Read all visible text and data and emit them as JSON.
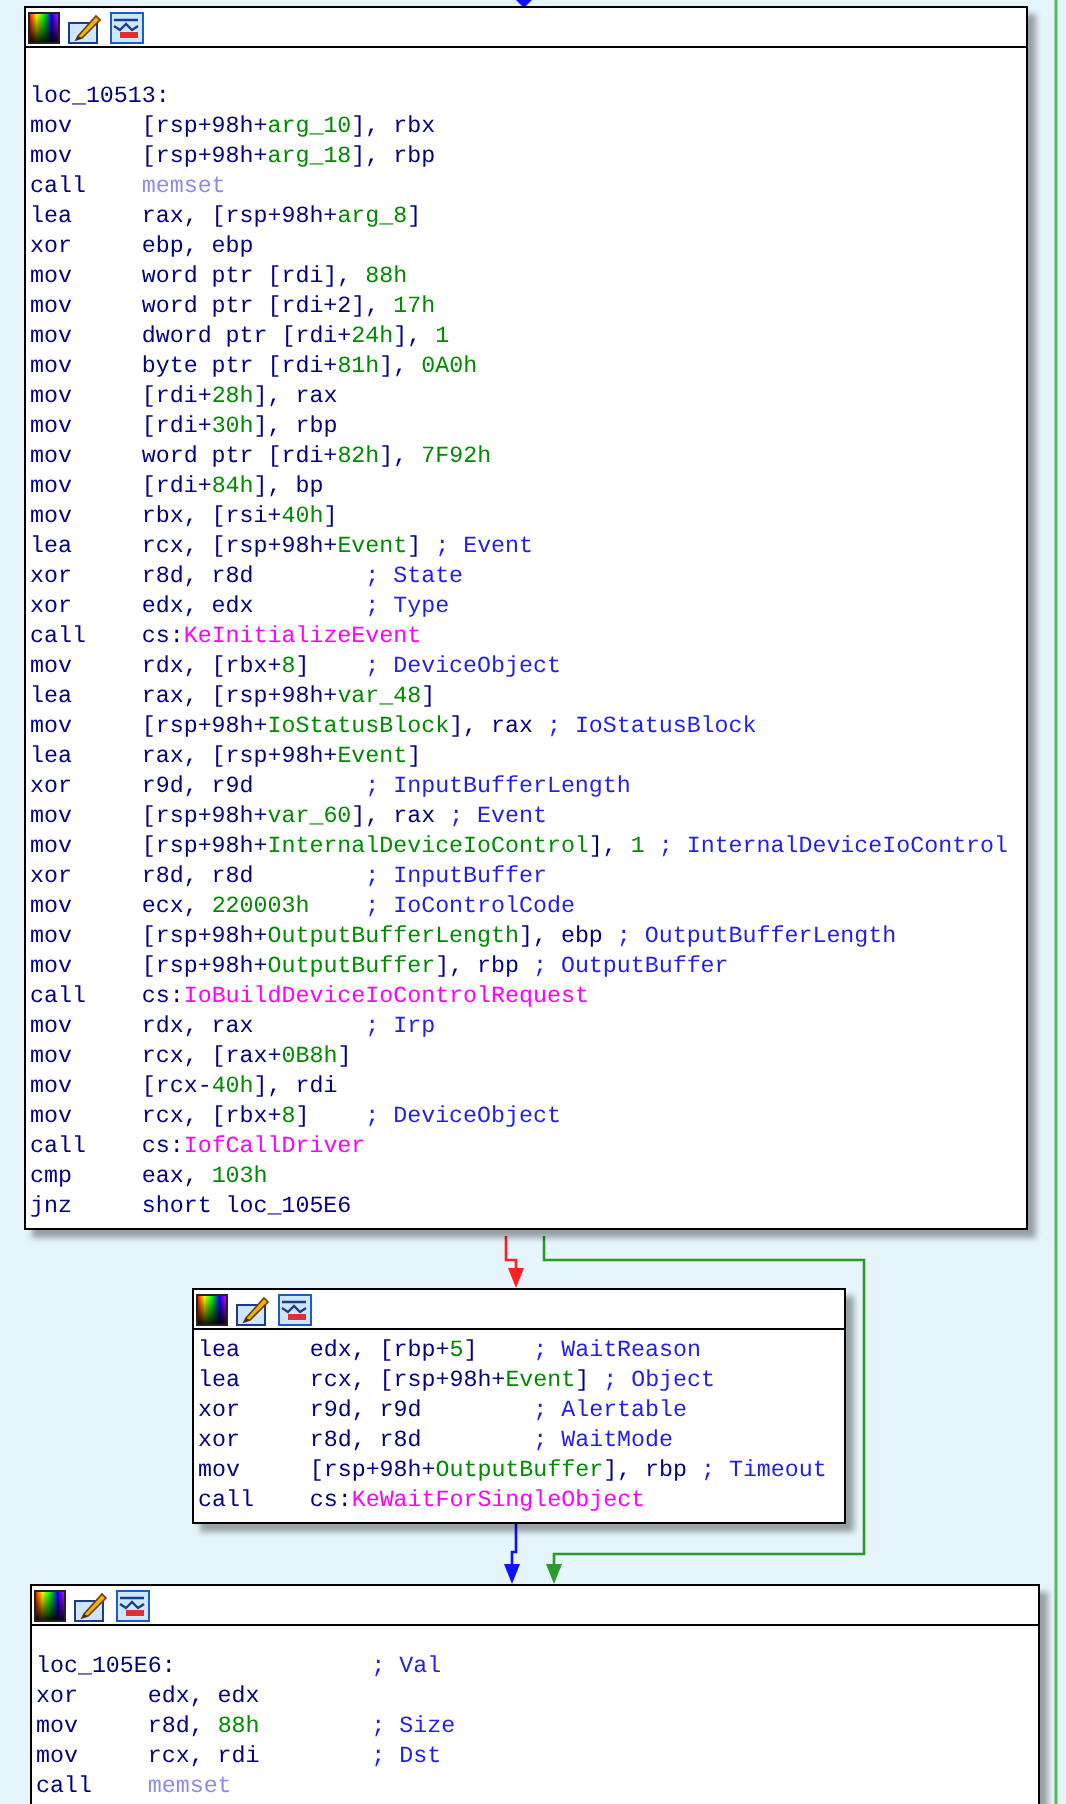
{
  "blocks": [
    {
      "lines": [
        {
          "kind": "label",
          "op": "loc_10513:"
        },
        {
          "kind": "insn",
          "op": "mov",
          "args": [
            {
              "text": "[rsp+98h+",
              "kind": "plain"
            },
            {
              "text": "arg_10",
              "kind": "var"
            },
            {
              "text": "], rbx",
              "kind": "plain"
            }
          ]
        },
        {
          "kind": "insn",
          "op": "mov",
          "args": [
            {
              "text": "[rsp+98h+",
              "kind": "plain"
            },
            {
              "text": "arg_18",
              "kind": "var"
            },
            {
              "text": "], rbp",
              "kind": "plain"
            }
          ]
        },
        {
          "kind": "insn",
          "op": "call",
          "args": [
            {
              "text": "memset",
              "kind": "libfunc"
            }
          ]
        },
        {
          "kind": "insn",
          "op": "lea",
          "args": [
            {
              "text": "rax, [rsp+98h+",
              "kind": "plain"
            },
            {
              "text": "arg_8",
              "kind": "var"
            },
            {
              "text": "]",
              "kind": "plain"
            }
          ]
        },
        {
          "kind": "insn",
          "op": "xor",
          "args": [
            {
              "text": "ebp, ebp",
              "kind": "plain"
            }
          ]
        },
        {
          "kind": "insn",
          "op": "mov",
          "args": [
            {
              "text": "word ptr [rdi], ",
              "kind": "plain"
            },
            {
              "text": "88h",
              "kind": "number"
            }
          ]
        },
        {
          "kind": "insn",
          "op": "mov",
          "args": [
            {
              "text": "word ptr [rdi+2], ",
              "kind": "plain"
            },
            {
              "text": "17h",
              "kind": "number"
            }
          ]
        },
        {
          "kind": "insn",
          "op": "mov",
          "args": [
            {
              "text": "dword ptr [rdi+",
              "kind": "plain"
            },
            {
              "text": "24h",
              "kind": "number"
            },
            {
              "text": "], ",
              "kind": "plain"
            },
            {
              "text": "1",
              "kind": "number"
            }
          ]
        },
        {
          "kind": "insn",
          "op": "mov",
          "args": [
            {
              "text": "byte ptr [rdi+",
              "kind": "plain"
            },
            {
              "text": "81h",
              "kind": "number"
            },
            {
              "text": "], ",
              "kind": "plain"
            },
            {
              "text": "0A0h",
              "kind": "number"
            }
          ]
        },
        {
          "kind": "insn",
          "op": "mov",
          "args": [
            {
              "text": "[rdi+",
              "kind": "plain"
            },
            {
              "text": "28h",
              "kind": "number"
            },
            {
              "text": "], rax",
              "kind": "plain"
            }
          ]
        },
        {
          "kind": "insn",
          "op": "mov",
          "args": [
            {
              "text": "[rdi+",
              "kind": "plain"
            },
            {
              "text": "30h",
              "kind": "number"
            },
            {
              "text": "], rbp",
              "kind": "plain"
            }
          ]
        },
        {
          "kind": "insn",
          "op": "mov",
          "args": [
            {
              "text": "word ptr [rdi+",
              "kind": "plain"
            },
            {
              "text": "82h",
              "kind": "number"
            },
            {
              "text": "], ",
              "kind": "plain"
            },
            {
              "text": "7F92h",
              "kind": "number"
            }
          ]
        },
        {
          "kind": "insn",
          "op": "mov",
          "args": [
            {
              "text": "[rdi+",
              "kind": "plain"
            },
            {
              "text": "84h",
              "kind": "number"
            },
            {
              "text": "], bp",
              "kind": "plain"
            }
          ]
        },
        {
          "kind": "insn",
          "op": "mov",
          "args": [
            {
              "text": "rbx, [rsi+",
              "kind": "plain"
            },
            {
              "text": "40h",
              "kind": "number"
            },
            {
              "text": "]",
              "kind": "plain"
            }
          ]
        },
        {
          "kind": "insn",
          "op": "lea",
          "args": [
            {
              "text": "rcx, [rsp+98h+",
              "kind": "plain"
            },
            {
              "text": "Event",
              "kind": "var"
            },
            {
              "text": "]",
              "kind": "plain"
            }
          ],
          "comment": "; Event"
        },
        {
          "kind": "insn",
          "op": "xor",
          "args": [
            {
              "text": "r8d, r8d",
              "kind": "plain"
            }
          ],
          "comment": "; State"
        },
        {
          "kind": "insn",
          "op": "xor",
          "args": [
            {
              "text": "edx, edx",
              "kind": "plain"
            }
          ],
          "comment": "; Type"
        },
        {
          "kind": "insn",
          "op": "call",
          "args": [
            {
              "text": "cs:",
              "kind": "plain"
            },
            {
              "text": "KeInitializeEvent",
              "kind": "import"
            }
          ]
        },
        {
          "kind": "insn",
          "op": "mov",
          "args": [
            {
              "text": "rdx, [rbx+",
              "kind": "plain"
            },
            {
              "text": "8",
              "kind": "number"
            },
            {
              "text": "]",
              "kind": "plain"
            }
          ],
          "comment": "; DeviceObject"
        },
        {
          "kind": "insn",
          "op": "lea",
          "args": [
            {
              "text": "rax, [rsp+98h+",
              "kind": "plain"
            },
            {
              "text": "var_48",
              "kind": "var"
            },
            {
              "text": "]",
              "kind": "plain"
            }
          ]
        },
        {
          "kind": "insn",
          "op": "mov",
          "args": [
            {
              "text": "[rsp+98h+",
              "kind": "plain"
            },
            {
              "text": "IoStatusBlock",
              "kind": "var"
            },
            {
              "text": "], rax",
              "kind": "plain"
            }
          ],
          "comment": "; IoStatusBlock"
        },
        {
          "kind": "insn",
          "op": "lea",
          "args": [
            {
              "text": "rax, [rsp+98h+",
              "kind": "plain"
            },
            {
              "text": "Event",
              "kind": "var"
            },
            {
              "text": "]",
              "kind": "plain"
            }
          ]
        },
        {
          "kind": "insn",
          "op": "xor",
          "args": [
            {
              "text": "r9d, r9d",
              "kind": "plain"
            }
          ],
          "comment": "; InputBufferLength"
        },
        {
          "kind": "insn",
          "op": "mov",
          "args": [
            {
              "text": "[rsp+98h+",
              "kind": "plain"
            },
            {
              "text": "var_60",
              "kind": "var"
            },
            {
              "text": "], rax",
              "kind": "plain"
            }
          ],
          "comment": "; Event"
        },
        {
          "kind": "insn",
          "op": "mov",
          "args": [
            {
              "text": "[rsp+98h+",
              "kind": "plain"
            },
            {
              "text": "InternalDeviceIoControl",
              "kind": "var"
            },
            {
              "text": "], ",
              "kind": "plain"
            },
            {
              "text": "1",
              "kind": "number"
            }
          ],
          "comment": "; InternalDeviceIoControl"
        },
        {
          "kind": "insn",
          "op": "xor",
          "args": [
            {
              "text": "r8d, r8d",
              "kind": "plain"
            }
          ],
          "comment": "; InputBuffer"
        },
        {
          "kind": "insn",
          "op": "mov",
          "args": [
            {
              "text": "ecx, ",
              "kind": "plain"
            },
            {
              "text": "220003h",
              "kind": "number"
            }
          ],
          "comment": "; IoControlCode"
        },
        {
          "kind": "insn",
          "op": "mov",
          "args": [
            {
              "text": "[rsp+98h+",
              "kind": "plain"
            },
            {
              "text": "OutputBufferLength",
              "kind": "var"
            },
            {
              "text": "], ebp",
              "kind": "plain"
            }
          ],
          "comment": "; OutputBufferLength"
        },
        {
          "kind": "insn",
          "op": "mov",
          "args": [
            {
              "text": "[rsp+98h+",
              "kind": "plain"
            },
            {
              "text": "OutputBuffer",
              "kind": "var"
            },
            {
              "text": "], rbp",
              "kind": "plain"
            }
          ],
          "comment": "; OutputBuffer"
        },
        {
          "kind": "insn",
          "op": "call",
          "args": [
            {
              "text": "cs:",
              "kind": "plain"
            },
            {
              "text": "IoBuildDeviceIoControlRequest",
              "kind": "import"
            }
          ]
        },
        {
          "kind": "insn",
          "op": "mov",
          "args": [
            {
              "text": "rdx, rax",
              "kind": "plain"
            }
          ],
          "comment": "; Irp"
        },
        {
          "kind": "insn",
          "op": "mov",
          "args": [
            {
              "text": "rcx, [rax+",
              "kind": "plain"
            },
            {
              "text": "0B8h",
              "kind": "number"
            },
            {
              "text": "]",
              "kind": "plain"
            }
          ]
        },
        {
          "kind": "insn",
          "op": "mov",
          "args": [
            {
              "text": "[rcx-",
              "kind": "plain"
            },
            {
              "text": "40h",
              "kind": "number"
            },
            {
              "text": "], rdi",
              "kind": "plain"
            }
          ]
        },
        {
          "kind": "insn",
          "op": "mov",
          "args": [
            {
              "text": "rcx, [rbx+",
              "kind": "plain"
            },
            {
              "text": "8",
              "kind": "number"
            },
            {
              "text": "]",
              "kind": "plain"
            }
          ],
          "comment": "; DeviceObject"
        },
        {
          "kind": "insn",
          "op": "call",
          "args": [
            {
              "text": "cs:",
              "kind": "plain"
            },
            {
              "text": "IofCallDriver",
              "kind": "import"
            }
          ]
        },
        {
          "kind": "insn",
          "op": "cmp",
          "args": [
            {
              "text": "eax, ",
              "kind": "plain"
            },
            {
              "text": "103h",
              "kind": "number"
            }
          ]
        },
        {
          "kind": "insn",
          "op": "jnz",
          "args": [
            {
              "text": "short loc_105E6",
              "kind": "plain"
            }
          ]
        }
      ]
    },
    {
      "lines": [
        {
          "kind": "insn",
          "op": "lea",
          "args": [
            {
              "text": "edx, [rbp+",
              "kind": "plain"
            },
            {
              "text": "5",
              "kind": "number"
            },
            {
              "text": "]",
              "kind": "plain"
            }
          ],
          "comment": "; WaitReason"
        },
        {
          "kind": "insn",
          "op": "lea",
          "args": [
            {
              "text": "rcx, [rsp+98h+",
              "kind": "plain"
            },
            {
              "text": "Event",
              "kind": "var"
            },
            {
              "text": "]",
              "kind": "plain"
            }
          ],
          "comment": "; Object"
        },
        {
          "kind": "insn",
          "op": "xor",
          "args": [
            {
              "text": "r9d, r9d",
              "kind": "plain"
            }
          ],
          "comment": "; Alertable"
        },
        {
          "kind": "insn",
          "op": "xor",
          "args": [
            {
              "text": "r8d, r8d",
              "kind": "plain"
            }
          ],
          "comment": "; WaitMode"
        },
        {
          "kind": "insn",
          "op": "mov",
          "args": [
            {
              "text": "[rsp+98h+",
              "kind": "plain"
            },
            {
              "text": "OutputBuffer",
              "kind": "var"
            },
            {
              "text": "], rbp",
              "kind": "plain"
            }
          ],
          "comment": "; Timeout"
        },
        {
          "kind": "insn",
          "op": "call",
          "args": [
            {
              "text": "cs:",
              "kind": "plain"
            },
            {
              "text": "KeWaitForSingleObject",
              "kind": "import"
            }
          ]
        }
      ]
    },
    {
      "lines": [
        {
          "kind": "label",
          "op": "loc_105E6:",
          "comment": "; Val"
        },
        {
          "kind": "insn",
          "op": "xor",
          "args": [
            {
              "text": "edx, edx",
              "kind": "plain"
            }
          ]
        },
        {
          "kind": "insn",
          "op": "mov",
          "args": [
            {
              "text": "r8d, ",
              "kind": "plain"
            },
            {
              "text": "88h",
              "kind": "number"
            }
          ],
          "comment": "; Size"
        },
        {
          "kind": "insn",
          "op": "mov",
          "args": [
            {
              "text": "rcx, rdi",
              "kind": "plain"
            }
          ],
          "comment": "; Dst"
        },
        {
          "kind": "insn",
          "op": "call",
          "args": [
            {
              "text": "memset",
              "kind": "libfunc"
            }
          ]
        }
      ]
    }
  ]
}
